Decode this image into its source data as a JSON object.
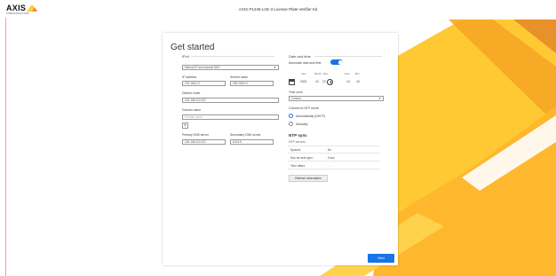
{
  "header": {
    "brand": "AXIS",
    "brand_sub": "COMMUNICATIONS",
    "title": "AXIS P1245-LVE-3 License Plate Verifier Kit"
  },
  "card": {
    "title": "Get started",
    "ipv4": {
      "heading": "IPv4",
      "mode_value": "Manual IP and manual DNS",
      "ip_label": "IP address",
      "ip_value": "192.168.2.2",
      "mask_label": "Subnet mask",
      "mask_value": "255.255.0.0",
      "router_label": "Default router",
      "router_value": "192.168.110.222",
      "domain_label": "Domain name",
      "domain_placeholder": "Domain name",
      "primary_dns_label": "Primary DNS server",
      "primary_dns_value": "192.168.110.222",
      "secondary_dns_label": "Secondary DNS server",
      "secondary_dns_value": "8.8.8.8"
    },
    "datetime": {
      "heading": "Date and time",
      "auto_label": "Automatic date and time",
      "year_label": "Year",
      "month_label": "Month",
      "day_label": "Day",
      "hour_label": "Hour",
      "min_label": "Min",
      "year_value": "2021",
      "month_value": "10",
      "day_value": "22",
      "hour_value": "14",
      "min_value": "15",
      "timezone_label": "Time zone",
      "timezone_value": "Custom",
      "ntp_connect_label": "Connect to NTP server",
      "option_auto": "Automatically (DHCP)",
      "option_manual": "Manually"
    },
    "ntp": {
      "heading": "NTP sync",
      "servers_label": "NTP servers",
      "rows": [
        {
          "k": "Synced:",
          "v": "No"
        },
        {
          "k": "Due for next sync:",
          "v": "0 sec"
        },
        {
          "k": "Time offset:",
          "v": "-"
        }
      ],
      "refresh_label": "Refresh information"
    },
    "next_label": "Next"
  },
  "colors": {
    "accent": "#1a73e8",
    "yellow": "#ffcc33",
    "orange": "#f5a623"
  }
}
